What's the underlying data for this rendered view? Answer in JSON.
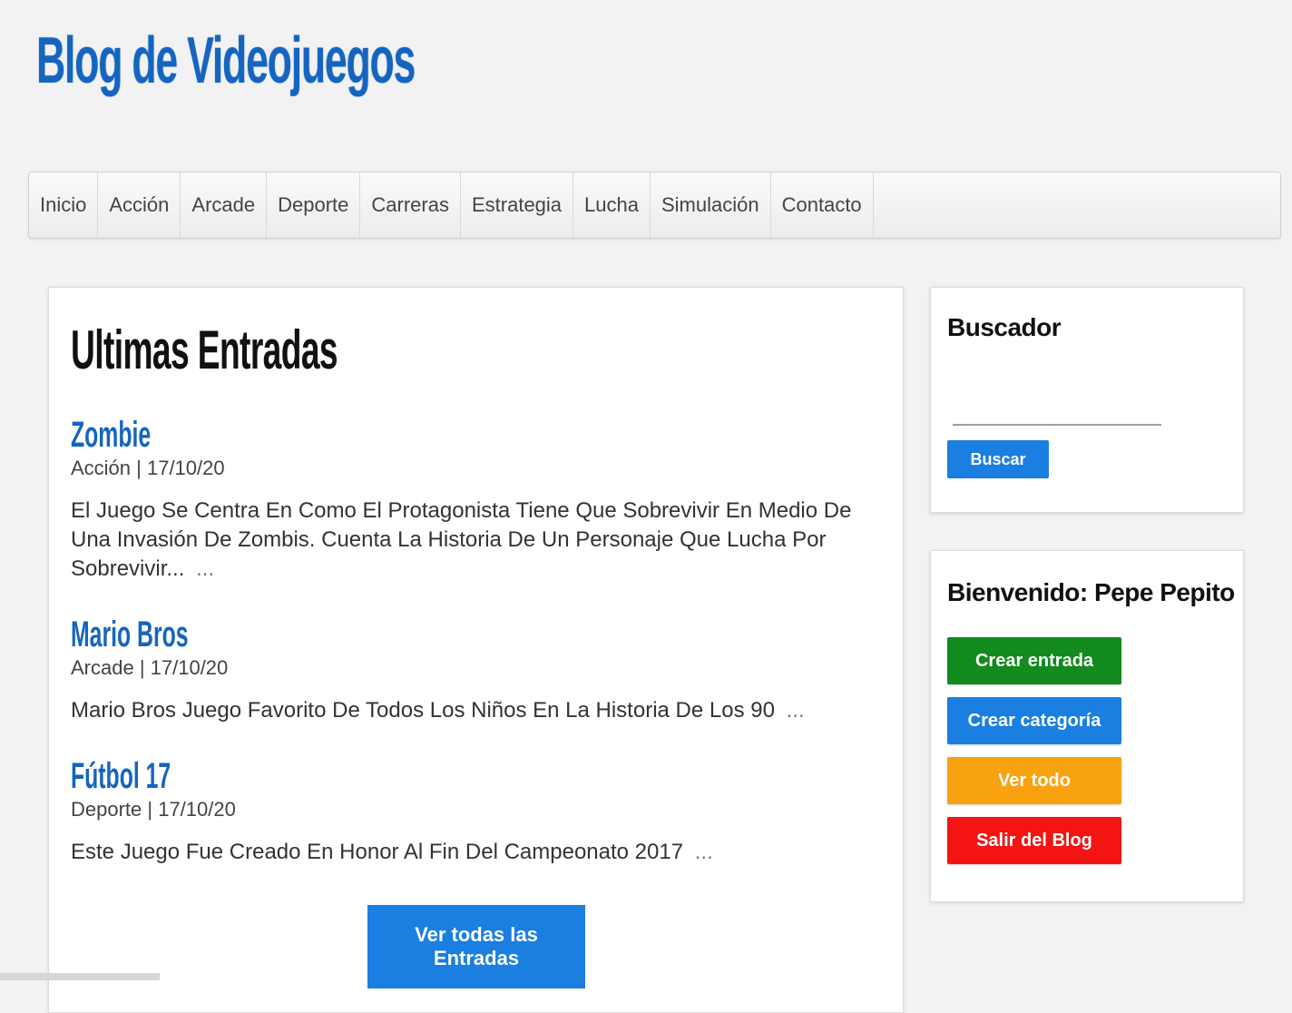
{
  "site": {
    "title": "Blog de Videojuegos"
  },
  "nav": {
    "items": [
      "Inicio",
      "Acción",
      "Arcade",
      "Deporte",
      "Carreras",
      "Estrategia",
      "Lucha",
      "Simulación",
      "Contacto"
    ]
  },
  "main": {
    "title": "Ultimas Entradas",
    "posts": [
      {
        "title": "Zombie",
        "meta": "Acción | 17/10/20",
        "excerpt": "El Juego Se Centra En Como El Protagonista Tiene Que Sobrevivir En Medio De Una Invasión De Zombis. Cuenta La Historia De Un Personaje Que Lucha Por Sobrevivir...",
        "more": "..."
      },
      {
        "title": "Mario Bros",
        "meta": "Arcade | 17/10/20",
        "excerpt": "Mario Bros Juego Favorito De Todos Los Niños En La Historia De Los 90",
        "more": "..."
      },
      {
        "title": "Fútbol 17",
        "meta": "Deporte | 17/10/20",
        "excerpt": "Este Juego Fue Creado En Honor Al Fin Del Campeonato 2017",
        "more": "..."
      }
    ],
    "view_all_label": "Ver todas las Entradas"
  },
  "sidebar": {
    "search": {
      "title": "Buscador",
      "placeholder": "",
      "button_label": "Buscar"
    },
    "welcome": {
      "title": "Bienvenido: Pepe Pepito",
      "buttons": [
        {
          "label": "Crear entrada",
          "color": "#128a1e"
        },
        {
          "label": "Crear categoría",
          "color": "#1a7fe0"
        },
        {
          "label": "Ver todo",
          "color": "#f9a20f"
        },
        {
          "label": "Salir del Blog",
          "color": "#f41414"
        }
      ]
    }
  }
}
